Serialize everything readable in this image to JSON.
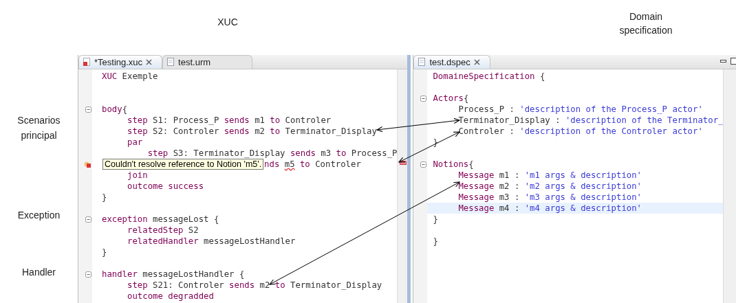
{
  "top_captions": [
    "XUC",
    "Domain specification"
  ],
  "side_captions": [
    "Scenarios principal",
    "Exception",
    "Handler"
  ],
  "editors": [
    {
      "tabs": [
        {
          "label": "*Testing.xuc",
          "selected": true,
          "has_error": true
        },
        {
          "label": "test.urm",
          "selected": false,
          "has_error": false
        }
      ],
      "lines": [
        {
          "kind": "code",
          "fold": false,
          "current": false,
          "segments": [
            {
              "kind": "keyword",
              "text": "XUC"
            },
            {
              "kind": "plain",
              "text": " Exemple"
            }
          ]
        },
        {
          "kind": "blank"
        },
        {
          "kind": "blank"
        },
        {
          "kind": "code",
          "fold": true,
          "current": false,
          "segments": [
            {
              "kind": "keyword",
              "text": "body"
            },
            {
              "kind": "plain",
              "text": "{"
            }
          ]
        },
        {
          "kind": "code",
          "fold": false,
          "current": false,
          "segments": [
            {
              "kind": "keyword",
              "text": "     step"
            },
            {
              "kind": "plain",
              "text": " S1: Process_P "
            },
            {
              "kind": "keyword",
              "text": "sends"
            },
            {
              "kind": "plain",
              "text": " m1 "
            },
            {
              "kind": "keyword",
              "text": "to"
            },
            {
              "kind": "plain",
              "text": " Controler"
            }
          ]
        },
        {
          "kind": "code",
          "fold": false,
          "current": false,
          "segments": [
            {
              "kind": "keyword",
              "text": "     step"
            },
            {
              "kind": "plain",
              "text": " S2: Controler "
            },
            {
              "kind": "keyword",
              "text": "sends"
            },
            {
              "kind": "plain",
              "text": " m2 "
            },
            {
              "kind": "keyword",
              "text": "to"
            },
            {
              "kind": "plain",
              "text": " Terminator_Display"
            }
          ]
        },
        {
          "kind": "code",
          "fold": false,
          "current": false,
          "segments": [
            {
              "kind": "keyword",
              "text": "     par"
            }
          ]
        },
        {
          "kind": "code",
          "fold": false,
          "current": false,
          "segments": [
            {
              "kind": "keyword",
              "text": "         step"
            },
            {
              "kind": "plain",
              "text": " S3: Terminator_Display "
            },
            {
              "kind": "keyword",
              "text": "sends"
            },
            {
              "kind": "plain",
              "text": " m3 "
            },
            {
              "kind": "keyword",
              "text": "to"
            },
            {
              "kind": "plain",
              "text": " Process_P"
            }
          ]
        },
        {
          "kind": "error",
          "message": "Couldn't resolve reference to Notion 'm5'.",
          "segments": [
            {
              "kind": "keyword",
              "text": "nds "
            },
            {
              "kind": "unresolved",
              "text": "m5"
            },
            {
              "kind": "keyword",
              "text": " to"
            },
            {
              "kind": "plain",
              "text": " Controler"
            }
          ]
        },
        {
          "kind": "code",
          "fold": false,
          "current": false,
          "segments": [
            {
              "kind": "keyword",
              "text": "     join"
            }
          ]
        },
        {
          "kind": "code",
          "fold": false,
          "current": false,
          "segments": [
            {
              "kind": "keyword",
              "text": "     outcome success"
            }
          ]
        },
        {
          "kind": "code",
          "fold": false,
          "current": false,
          "segments": [
            {
              "kind": "plain",
              "text": "}"
            }
          ]
        },
        {
          "kind": "blank"
        },
        {
          "kind": "code",
          "fold": true,
          "current": false,
          "segments": [
            {
              "kind": "keyword",
              "text": "exception"
            },
            {
              "kind": "plain",
              "text": " messageLost {"
            }
          ]
        },
        {
          "kind": "code",
          "fold": false,
          "current": false,
          "segments": [
            {
              "kind": "keyword",
              "text": "     relatedStep"
            },
            {
              "kind": "plain",
              "text": " S2"
            }
          ]
        },
        {
          "kind": "code",
          "fold": false,
          "current": false,
          "segments": [
            {
              "kind": "keyword",
              "text": "     relatedHandler"
            },
            {
              "kind": "plain",
              "text": " messageLostHandler"
            }
          ]
        },
        {
          "kind": "code",
          "fold": false,
          "current": false,
          "segments": [
            {
              "kind": "plain",
              "text": "}"
            }
          ]
        },
        {
          "kind": "blank"
        },
        {
          "kind": "code",
          "fold": true,
          "current": false,
          "segments": [
            {
              "kind": "keyword",
              "text": "handler"
            },
            {
              "kind": "plain",
              "text": " messageLostHandler {"
            }
          ]
        },
        {
          "kind": "code",
          "fold": false,
          "current": false,
          "segments": [
            {
              "kind": "keyword",
              "text": "     step"
            },
            {
              "kind": "plain",
              "text": " S21: Controler "
            },
            {
              "kind": "keyword",
              "text": "sends"
            },
            {
              "kind": "plain",
              "text": " m2 "
            },
            {
              "kind": "keyword",
              "text": "to"
            },
            {
              "kind": "plain",
              "text": " Terminator_Display"
            }
          ]
        },
        {
          "kind": "code",
          "fold": false,
          "current": false,
          "segments": [
            {
              "kind": "keyword",
              "text": "     outcome degradded"
            }
          ]
        }
      ]
    },
    {
      "tabs": [
        {
          "label": "test.dspec",
          "selected": true,
          "has_error": false
        }
      ],
      "lines": [
        {
          "kind": "code",
          "fold": false,
          "current": false,
          "segments": [
            {
              "kind": "keyword",
              "text": "DomaineSpecification"
            },
            {
              "kind": "plain",
              "text": " {"
            }
          ]
        },
        {
          "kind": "blank"
        },
        {
          "kind": "code",
          "fold": true,
          "current": false,
          "segments": [
            {
              "kind": "keyword",
              "text": "Actors"
            },
            {
              "kind": "plain",
              "text": "{"
            }
          ]
        },
        {
          "kind": "code",
          "fold": false,
          "current": false,
          "segments": [
            {
              "kind": "plain",
              "text": "     Process_P : "
            },
            {
              "kind": "string",
              "text": "'description of the Process_P actor'"
            }
          ]
        },
        {
          "kind": "code",
          "fold": false,
          "current": false,
          "segments": [
            {
              "kind": "plain",
              "text": "     Terminator_Display : "
            },
            {
              "kind": "string",
              "text": "'description of the Terminator_"
            }
          ]
        },
        {
          "kind": "code",
          "fold": false,
          "current": false,
          "segments": [
            {
              "kind": "plain",
              "text": "     Controler : "
            },
            {
              "kind": "string",
              "text": "'description of the Controler actor'"
            }
          ]
        },
        {
          "kind": "code",
          "fold": false,
          "current": false,
          "segments": [
            {
              "kind": "plain",
              "text": "}"
            }
          ]
        },
        {
          "kind": "blank"
        },
        {
          "kind": "code",
          "fold": true,
          "current": false,
          "segments": [
            {
              "kind": "keyword",
              "text": "Notions"
            },
            {
              "kind": "plain",
              "text": "{"
            }
          ]
        },
        {
          "kind": "code",
          "fold": false,
          "current": false,
          "segments": [
            {
              "kind": "keyword",
              "text": "     Message"
            },
            {
              "kind": "plain",
              "text": " m1 : "
            },
            {
              "kind": "string",
              "text": "'m1 args & description'"
            }
          ]
        },
        {
          "kind": "code",
          "fold": false,
          "current": false,
          "segments": [
            {
              "kind": "keyword",
              "text": "     Message"
            },
            {
              "kind": "plain",
              "text": " m2 : "
            },
            {
              "kind": "string",
              "text": "'m2 args & description'"
            }
          ]
        },
        {
          "kind": "code",
          "fold": false,
          "current": false,
          "segments": [
            {
              "kind": "keyword",
              "text": "     Message"
            },
            {
              "kind": "plain",
              "text": " m3 : "
            },
            {
              "kind": "string",
              "text": "'m3 args & description'"
            }
          ]
        },
        {
          "kind": "code",
          "fold": false,
          "current": true,
          "segments": [
            {
              "kind": "keyword",
              "text": "     Message"
            },
            {
              "kind": "plain",
              "text": " m4 : "
            },
            {
              "kind": "string",
              "text": "'m4 args & description'"
            }
          ]
        },
        {
          "kind": "code",
          "fold": false,
          "current": false,
          "segments": [
            {
              "kind": "plain",
              "text": "}"
            }
          ]
        },
        {
          "kind": "blank"
        },
        {
          "kind": "code",
          "fold": false,
          "current": false,
          "segments": [
            {
              "kind": "plain",
              "text": "}"
            }
          ]
        }
      ]
    }
  ]
}
